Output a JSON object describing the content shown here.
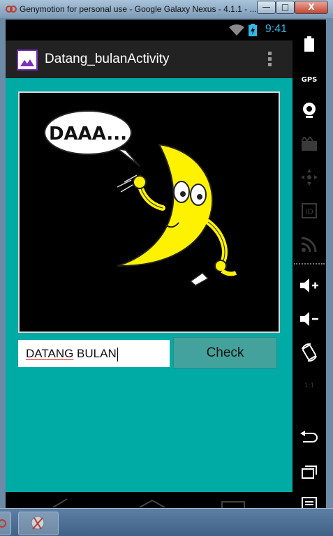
{
  "window": {
    "title": "Genymotion for personal use - Google Galaxy Nexus - 4.1.1 - ...",
    "minimize_label": "—",
    "maximize_label": "□",
    "close_label": "X"
  },
  "statusbar": {
    "time": "9:41",
    "battery_icon": "battery-charging-icon",
    "signal_icon": "wifi-icon"
  },
  "actionbar": {
    "title": "Datang_bulanActivity",
    "app_icon": "image-gallery-icon",
    "overflow_icon": "overflow-menu-icon"
  },
  "image": {
    "speech_text": "DAAA..."
  },
  "input": {
    "word1": "DATANG",
    "word2": " BULAN"
  },
  "check_button": {
    "label": "Check"
  },
  "side_toolbar": {
    "gps_label": "GPS",
    "ratio_label": "1:1"
  },
  "colors": {
    "background": "#00aaa5",
    "action_bar": "#222222",
    "button": "#44a29c",
    "status_accent": "#33b5e5",
    "moon": "#fff200"
  }
}
